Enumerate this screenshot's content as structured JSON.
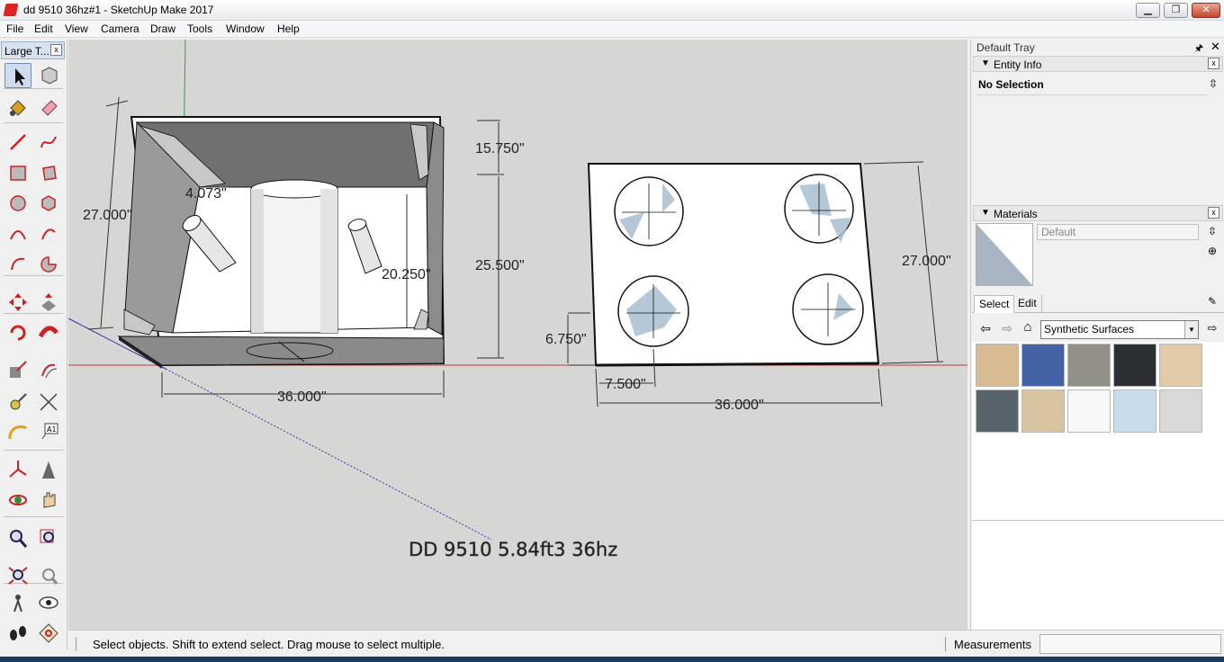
{
  "window": {
    "title": "dd 9510 36hz#1 - SketchUp Make 2017",
    "min_label": "▁",
    "max_label": "❐",
    "close_label": "✕"
  },
  "menu": [
    {
      "label": "File"
    },
    {
      "label": "Edit"
    },
    {
      "label": "View"
    },
    {
      "label": "Camera"
    },
    {
      "label": "Draw"
    },
    {
      "label": "Tools"
    },
    {
      "label": "Window"
    },
    {
      "label": "Help"
    }
  ],
  "toolbar": {
    "title": "Large T...",
    "close": "x",
    "tools": [
      {
        "name": "select-tool-icon"
      },
      {
        "name": "make-component-icon"
      },
      {
        "name": "paint-bucket-icon"
      },
      {
        "name": "eraser-icon"
      },
      {
        "name": "line-tool-icon"
      },
      {
        "name": "freehand-icon"
      },
      {
        "name": "rectangle-icon"
      },
      {
        "name": "rotated-rectangle-icon"
      },
      {
        "name": "circle-icon"
      },
      {
        "name": "polygon-icon"
      },
      {
        "name": "arc-icon"
      },
      {
        "name": "two-point-arc-icon"
      },
      {
        "name": "three-point-arc-icon"
      },
      {
        "name": "pie-icon"
      },
      {
        "name": "move-icon"
      },
      {
        "name": "push-pull-icon"
      },
      {
        "name": "rotate-icon"
      },
      {
        "name": "follow-me-icon"
      },
      {
        "name": "scale-icon"
      },
      {
        "name": "offset-icon"
      },
      {
        "name": "tape-measure-icon"
      },
      {
        "name": "dimension-icon"
      },
      {
        "name": "protractor-icon"
      },
      {
        "name": "text-tool-icon"
      },
      {
        "name": "axes-icon"
      },
      {
        "name": "3d-text-icon"
      },
      {
        "name": "orbit-icon"
      },
      {
        "name": "pan-icon"
      },
      {
        "name": "zoom-icon"
      },
      {
        "name": "zoom-window-icon"
      },
      {
        "name": "zoom-extents-icon"
      },
      {
        "name": "previous-view-icon"
      },
      {
        "name": "position-camera-icon"
      },
      {
        "name": "look-around-icon"
      },
      {
        "name": "walk-icon"
      },
      {
        "name": "section-plane-icon"
      }
    ]
  },
  "viewport": {
    "model_text": "DD 9510 5.84ft3 36hz",
    "dimensions": {
      "left_height": "27.000\"",
      "port_top": "15.750\"",
      "port_bottom": "25.500\"",
      "corner": "4.073\"",
      "inner": "20.250\"",
      "left_width": "36.000\"",
      "right_height": "27.000\"",
      "offset_vertical": "6.750\"",
      "offset_horizontal": "7.500\"",
      "right_width": "36.000\""
    }
  },
  "status": {
    "hint": "Select objects. Shift to extend select. Drag mouse to select multiple.",
    "measurements_label": "Measurements",
    "measurements_value": ""
  },
  "tray": {
    "title": "Default Tray",
    "pin": "🖈",
    "close": "✕",
    "entity_info": {
      "title": "Entity Info",
      "selection": "No Selection"
    },
    "materials": {
      "title": "Materials",
      "name_placeholder": "Default",
      "tabs": [
        "Select",
        "Edit"
      ],
      "library": "Synthetic Surfaces",
      "swatches": [
        {
          "name": "Tan Carpet",
          "color": "#d7bb92"
        },
        {
          "name": "Blue Solid",
          "color": "#4462a6"
        },
        {
          "name": "Grey Stone",
          "color": "#929087"
        },
        {
          "name": "Black Granite",
          "color": "#2c2f33"
        },
        {
          "name": "Light Wood",
          "color": "#e2c9a8"
        },
        {
          "name": "Slate Grey",
          "color": "#59636b"
        },
        {
          "name": "Beige Fabric",
          "color": "#d9c4a2"
        },
        {
          "name": "White",
          "color": "#f7f9f9"
        },
        {
          "name": "Light Blue Speckle",
          "color": "#c7dbea"
        },
        {
          "name": "Light Grey Speckle",
          "color": "#d9d9d7"
        }
      ]
    }
  }
}
